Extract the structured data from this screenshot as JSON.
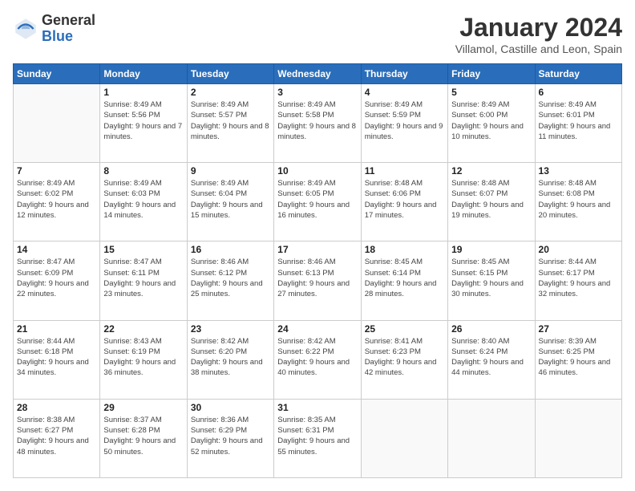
{
  "logo": {
    "general": "General",
    "blue": "Blue"
  },
  "header": {
    "month": "January 2024",
    "location": "Villamol, Castille and Leon, Spain"
  },
  "days_of_week": [
    "Sunday",
    "Monday",
    "Tuesday",
    "Wednesday",
    "Thursday",
    "Friday",
    "Saturday"
  ],
  "weeks": [
    [
      {
        "day": "",
        "sunrise": "",
        "sunset": "",
        "daylight": ""
      },
      {
        "day": "1",
        "sunrise": "Sunrise: 8:49 AM",
        "sunset": "Sunset: 5:56 PM",
        "daylight": "Daylight: 9 hours and 7 minutes."
      },
      {
        "day": "2",
        "sunrise": "Sunrise: 8:49 AM",
        "sunset": "Sunset: 5:57 PM",
        "daylight": "Daylight: 9 hours and 8 minutes."
      },
      {
        "day": "3",
        "sunrise": "Sunrise: 8:49 AM",
        "sunset": "Sunset: 5:58 PM",
        "daylight": "Daylight: 9 hours and 8 minutes."
      },
      {
        "day": "4",
        "sunrise": "Sunrise: 8:49 AM",
        "sunset": "Sunset: 5:59 PM",
        "daylight": "Daylight: 9 hours and 9 minutes."
      },
      {
        "day": "5",
        "sunrise": "Sunrise: 8:49 AM",
        "sunset": "Sunset: 6:00 PM",
        "daylight": "Daylight: 9 hours and 10 minutes."
      },
      {
        "day": "6",
        "sunrise": "Sunrise: 8:49 AM",
        "sunset": "Sunset: 6:01 PM",
        "daylight": "Daylight: 9 hours and 11 minutes."
      }
    ],
    [
      {
        "day": "7",
        "sunrise": "Sunrise: 8:49 AM",
        "sunset": "Sunset: 6:02 PM",
        "daylight": "Daylight: 9 hours and 12 minutes."
      },
      {
        "day": "8",
        "sunrise": "Sunrise: 8:49 AM",
        "sunset": "Sunset: 6:03 PM",
        "daylight": "Daylight: 9 hours and 14 minutes."
      },
      {
        "day": "9",
        "sunrise": "Sunrise: 8:49 AM",
        "sunset": "Sunset: 6:04 PM",
        "daylight": "Daylight: 9 hours and 15 minutes."
      },
      {
        "day": "10",
        "sunrise": "Sunrise: 8:49 AM",
        "sunset": "Sunset: 6:05 PM",
        "daylight": "Daylight: 9 hours and 16 minutes."
      },
      {
        "day": "11",
        "sunrise": "Sunrise: 8:48 AM",
        "sunset": "Sunset: 6:06 PM",
        "daylight": "Daylight: 9 hours and 17 minutes."
      },
      {
        "day": "12",
        "sunrise": "Sunrise: 8:48 AM",
        "sunset": "Sunset: 6:07 PM",
        "daylight": "Daylight: 9 hours and 19 minutes."
      },
      {
        "day": "13",
        "sunrise": "Sunrise: 8:48 AM",
        "sunset": "Sunset: 6:08 PM",
        "daylight": "Daylight: 9 hours and 20 minutes."
      }
    ],
    [
      {
        "day": "14",
        "sunrise": "Sunrise: 8:47 AM",
        "sunset": "Sunset: 6:09 PM",
        "daylight": "Daylight: 9 hours and 22 minutes."
      },
      {
        "day": "15",
        "sunrise": "Sunrise: 8:47 AM",
        "sunset": "Sunset: 6:11 PM",
        "daylight": "Daylight: 9 hours and 23 minutes."
      },
      {
        "day": "16",
        "sunrise": "Sunrise: 8:46 AM",
        "sunset": "Sunset: 6:12 PM",
        "daylight": "Daylight: 9 hours and 25 minutes."
      },
      {
        "day": "17",
        "sunrise": "Sunrise: 8:46 AM",
        "sunset": "Sunset: 6:13 PM",
        "daylight": "Daylight: 9 hours and 27 minutes."
      },
      {
        "day": "18",
        "sunrise": "Sunrise: 8:45 AM",
        "sunset": "Sunset: 6:14 PM",
        "daylight": "Daylight: 9 hours and 28 minutes."
      },
      {
        "day": "19",
        "sunrise": "Sunrise: 8:45 AM",
        "sunset": "Sunset: 6:15 PM",
        "daylight": "Daylight: 9 hours and 30 minutes."
      },
      {
        "day": "20",
        "sunrise": "Sunrise: 8:44 AM",
        "sunset": "Sunset: 6:17 PM",
        "daylight": "Daylight: 9 hours and 32 minutes."
      }
    ],
    [
      {
        "day": "21",
        "sunrise": "Sunrise: 8:44 AM",
        "sunset": "Sunset: 6:18 PM",
        "daylight": "Daylight: 9 hours and 34 minutes."
      },
      {
        "day": "22",
        "sunrise": "Sunrise: 8:43 AM",
        "sunset": "Sunset: 6:19 PM",
        "daylight": "Daylight: 9 hours and 36 minutes."
      },
      {
        "day": "23",
        "sunrise": "Sunrise: 8:42 AM",
        "sunset": "Sunset: 6:20 PM",
        "daylight": "Daylight: 9 hours and 38 minutes."
      },
      {
        "day": "24",
        "sunrise": "Sunrise: 8:42 AM",
        "sunset": "Sunset: 6:22 PM",
        "daylight": "Daylight: 9 hours and 40 minutes."
      },
      {
        "day": "25",
        "sunrise": "Sunrise: 8:41 AM",
        "sunset": "Sunset: 6:23 PM",
        "daylight": "Daylight: 9 hours and 42 minutes."
      },
      {
        "day": "26",
        "sunrise": "Sunrise: 8:40 AM",
        "sunset": "Sunset: 6:24 PM",
        "daylight": "Daylight: 9 hours and 44 minutes."
      },
      {
        "day": "27",
        "sunrise": "Sunrise: 8:39 AM",
        "sunset": "Sunset: 6:25 PM",
        "daylight": "Daylight: 9 hours and 46 minutes."
      }
    ],
    [
      {
        "day": "28",
        "sunrise": "Sunrise: 8:38 AM",
        "sunset": "Sunset: 6:27 PM",
        "daylight": "Daylight: 9 hours and 48 minutes."
      },
      {
        "day": "29",
        "sunrise": "Sunrise: 8:37 AM",
        "sunset": "Sunset: 6:28 PM",
        "daylight": "Daylight: 9 hours and 50 minutes."
      },
      {
        "day": "30",
        "sunrise": "Sunrise: 8:36 AM",
        "sunset": "Sunset: 6:29 PM",
        "daylight": "Daylight: 9 hours and 52 minutes."
      },
      {
        "day": "31",
        "sunrise": "Sunrise: 8:35 AM",
        "sunset": "Sunset: 6:31 PM",
        "daylight": "Daylight: 9 hours and 55 minutes."
      },
      {
        "day": "",
        "sunrise": "",
        "sunset": "",
        "daylight": ""
      },
      {
        "day": "",
        "sunrise": "",
        "sunset": "",
        "daylight": ""
      },
      {
        "day": "",
        "sunrise": "",
        "sunset": "",
        "daylight": ""
      }
    ]
  ]
}
